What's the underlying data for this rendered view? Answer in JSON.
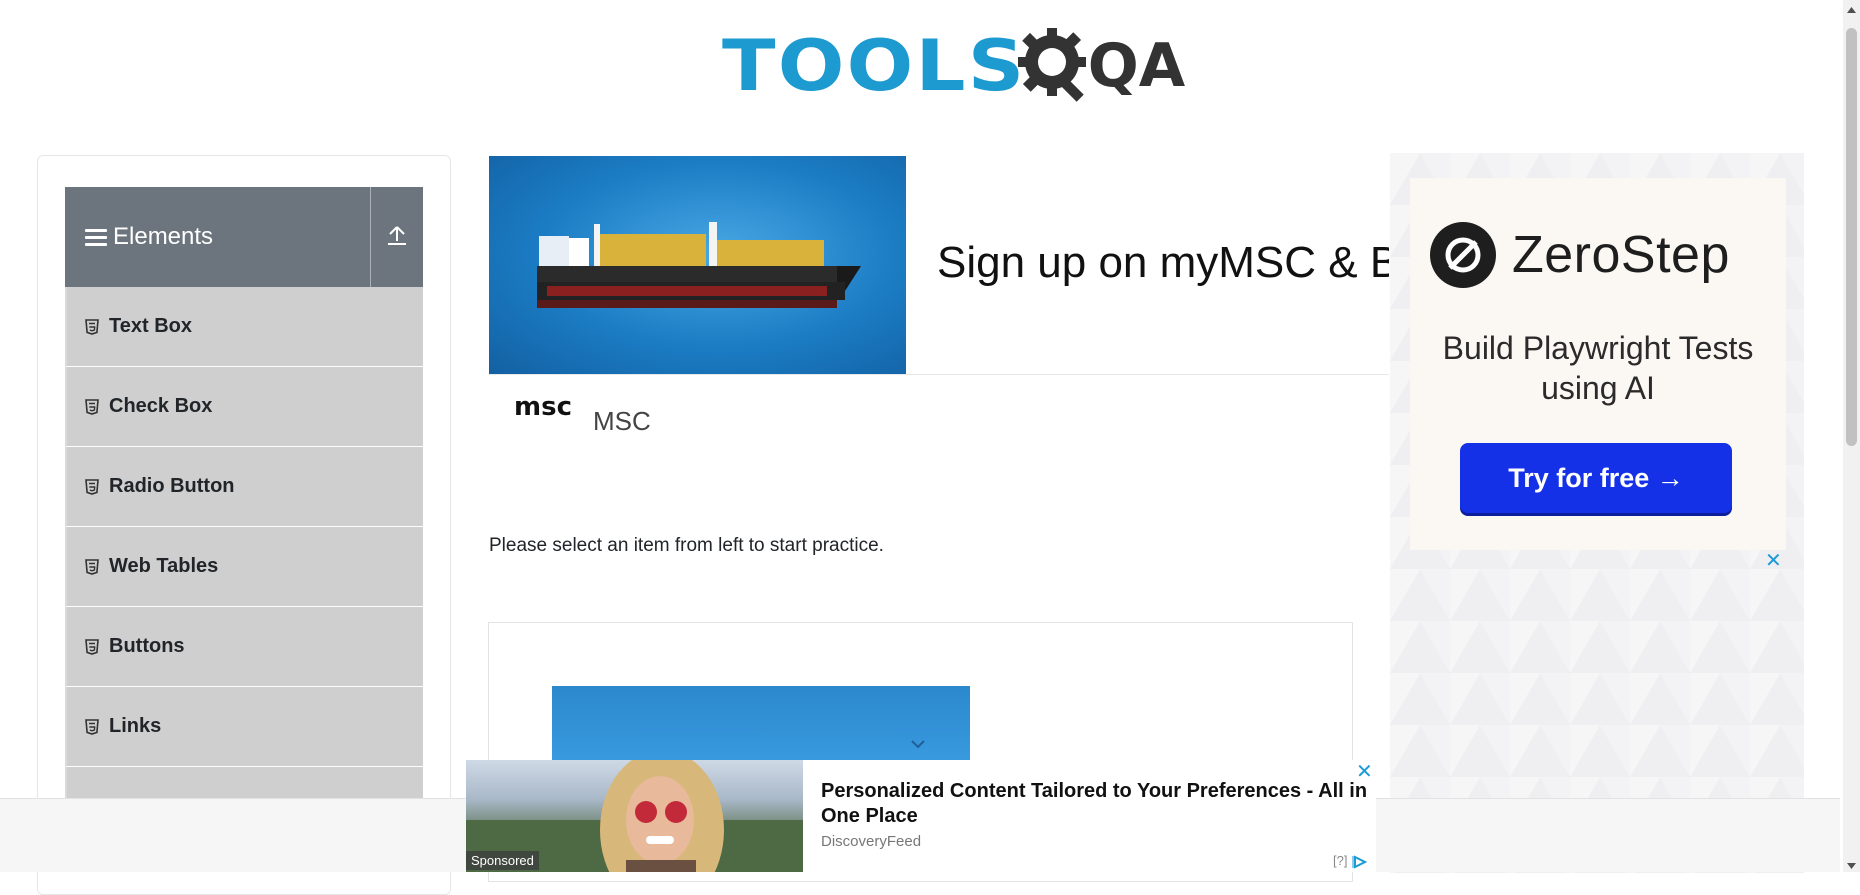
{
  "header": {
    "logo_text": "TOOLS",
    "logo_suffix": "QA"
  },
  "sidebar": {
    "group_title": "Elements",
    "items": [
      {
        "label": "Text Box"
      },
      {
        "label": "Check Box"
      },
      {
        "label": "Radio Button"
      },
      {
        "label": "Web Tables"
      },
      {
        "label": "Buttons"
      },
      {
        "label": "Links"
      },
      {
        "label": ""
      }
    ]
  },
  "main_ad": {
    "headline": "Sign up on myMSC & B",
    "brand_logo": "msc",
    "brand_name": "MSC"
  },
  "main": {
    "practice_text": "Please select an item from left to start practice."
  },
  "right_ad": {
    "brand": "ZeroStep",
    "tagline": "Build Playwright Tests using AI",
    "button_label": "Try for free →",
    "close": "✕",
    "accent_color": "#1431e8"
  },
  "sponsored": {
    "label": "Sponsored",
    "title": "Personalized Content Tailored to Your Preferences - All in One Place",
    "source": "DiscoveryFeed",
    "close": "✕",
    "adchoice": "[?]"
  },
  "colors": {
    "logo_blue": "#1d9bd1",
    "sidebar_header": "#6c757d",
    "menu_item_bg": "#cfcfcf"
  }
}
